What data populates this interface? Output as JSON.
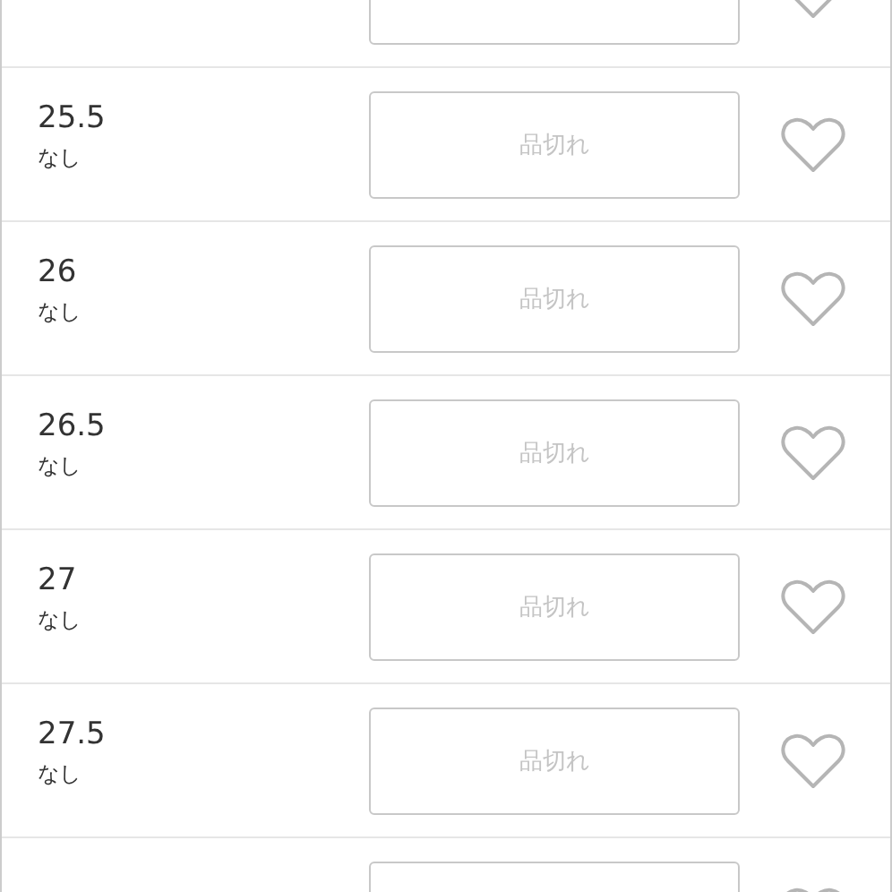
{
  "rows": [
    {
      "button": {}
    },
    {
      "size": "25.5",
      "stock": "なし",
      "button": {
        "label": "品切れ",
        "disabled": true
      }
    },
    {
      "size": "26",
      "stock": "なし",
      "button": {
        "label": "品切れ",
        "disabled": true
      }
    },
    {
      "size": "26.5",
      "stock": "なし",
      "button": {
        "label": "品切れ",
        "disabled": true
      }
    },
    {
      "size": "27",
      "stock": "なし",
      "button": {
        "label": "品切れ",
        "disabled": true
      }
    },
    {
      "size": "27.5",
      "stock": "なし",
      "button": {
        "label": "品切れ",
        "disabled": true
      }
    },
    {
      "button": {}
    }
  ]
}
